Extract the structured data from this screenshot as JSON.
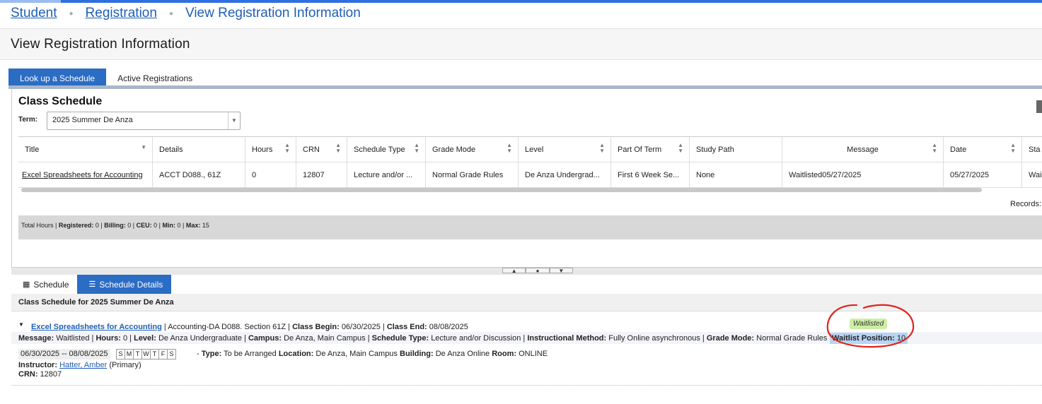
{
  "breadcrumb": {
    "items": [
      "Student",
      "Registration"
    ],
    "current": "View Registration Information"
  },
  "page_title": "View Registration Information",
  "tabs": [
    "Look up a Schedule",
    "Active Registrations"
  ],
  "class_schedule": {
    "title": "Class Schedule",
    "term_label": "Term:",
    "term_value": "2025 Summer De Anza",
    "columns": [
      "Title",
      "Details",
      "Hours",
      "CRN",
      "Schedule Type",
      "Grade Mode",
      "Level",
      "Part Of Term",
      "Study Path",
      "Message",
      "Date",
      "Sta"
    ],
    "row": {
      "title": "Excel Spreadsheets for Accounting",
      "details": "ACCT D088., 61Z",
      "hours": "0",
      "crn": "12807",
      "schedule_type": "Lecture and/or ...",
      "grade_mode": "Normal Grade Rules",
      "level": "De Anza Undergrad...",
      "part_of_term": "First 6 Week Se...",
      "study_path": "None",
      "message": "Waitlisted05/27/2025",
      "date": "05/27/2025",
      "status": "Wai"
    },
    "records_label": "Records:",
    "totals": {
      "total_hours": "Total Hours",
      "registered_label": "Registered:",
      "registered": "0",
      "billing_label": "Billing:",
      "billing": "0",
      "ceu_label": "CEU:",
      "ceu": "0",
      "min_label": "Min:",
      "min": "0",
      "max_label": "Max:",
      "max": "15"
    }
  },
  "subtabs": [
    "Schedule",
    "Schedule Details"
  ],
  "detail": {
    "header": "Class Schedule for 2025 Summer De Anza",
    "course_link": "Excel Spreadsheets for Accounting",
    "course_info": "Accounting-DA D088. Section 61Z",
    "class_begin_label": "Class Begin:",
    "class_begin": "06/30/2025",
    "class_end_label": "Class End:",
    "class_end": "08/08/2025",
    "status_badge": "Waitlisted",
    "message_label": "Message:",
    "message": "Waitlisted",
    "hours_label": "Hours:",
    "hours": "0",
    "level_label": "Level:",
    "level": "De Anza Undergraduate",
    "campus_label": "Campus:",
    "campus": "De Anza, Main Campus",
    "schedule_type_label": "Schedule Type:",
    "schedule_type": "Lecture and/or Discussion",
    "method_label": "Instructional Method:",
    "method": "Fully Online asynchronous",
    "grade_mode_label": "Grade Mode:",
    "grade_mode": "Normal Grade Rules",
    "waitlist_label": "Waitlist Position:",
    "waitlist_position": "10",
    "meeting_dates": "06/30/2025 -- 08/08/2025",
    "days": [
      "S",
      "M",
      "T",
      "W",
      "T",
      "F",
      "S"
    ],
    "type_label": "Type:",
    "type": "To be Arranged",
    "location_label": "Location:",
    "location": "De Anza, Main Campus",
    "building_label": "Building:",
    "building": "De Anza Online",
    "room_label": "Room:",
    "room": "ONLINE",
    "instructor_label": "Instructor:",
    "instructor": "Hatter, Amber",
    "instructor_role": "(Primary)",
    "crn_label": "CRN:",
    "crn": "12807"
  },
  "colors": {
    "accent": "#2b6cc4",
    "link": "#1f5fb6",
    "waitlist_badge": "#cdeea5",
    "annotation": "#e0231c"
  }
}
